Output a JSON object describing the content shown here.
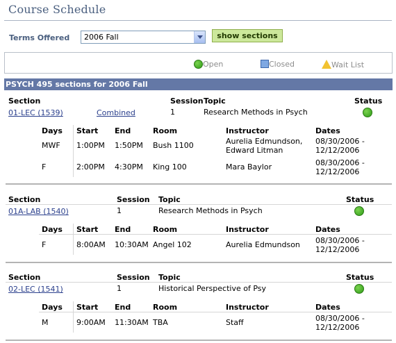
{
  "page": {
    "title": "Course Schedule"
  },
  "filter": {
    "label": "Terms Offered",
    "selected": "2006 Fall",
    "button": "show sections"
  },
  "legend": {
    "open": "Open",
    "closed": "Closed",
    "wait": "Wait List"
  },
  "banner": "PSYCH 495 sections for 2006 Fall",
  "section_headers": {
    "section": "Section",
    "session": "Session",
    "topic": "Topic",
    "status": "Status"
  },
  "meeting_headers": {
    "days": "Days",
    "start": "Start",
    "end": "End",
    "room": "Room",
    "instructor": "Instructor",
    "dates": "Dates"
  },
  "sections": [
    {
      "section": "01-LEC (1539)",
      "combined": "Combined",
      "session": "1",
      "topic": "Research Methods in Psych",
      "status": "Open",
      "meetings": [
        {
          "days": "MWF",
          "start": "1:00PM",
          "end": "1:50PM",
          "room": "Bush 1100",
          "instructor_1": "Aurelia Edmundson,",
          "instructor_2": "Edward Litman",
          "date_1": "08/30/2006 -",
          "date_2": "12/12/2006"
        },
        {
          "days": "F",
          "start": "2:00PM",
          "end": "4:30PM",
          "room": "King 100",
          "instructor_1": "Mara Baylor",
          "date_1": "08/30/2006 -",
          "date_2": "12/12/2006"
        }
      ]
    },
    {
      "section": "01A-LAB (1540)",
      "session": "1",
      "topic": "Research Methods in Psych",
      "status": "Open",
      "meetings": [
        {
          "days": "F",
          "start": "8:00AM",
          "end": "10:30AM",
          "room": "Angel 102",
          "instructor_1": "Aurelia Edmundson",
          "date_1": "08/30/2006 -",
          "date_2": "12/12/2006"
        }
      ]
    },
    {
      "section": "02-LEC (1541)",
      "session": "1",
      "topic": "Historical Perspective of Psy",
      "status": "Open",
      "meetings": [
        {
          "days": "M",
          "start": "9:00AM",
          "end": "11:30AM",
          "room": "TBA",
          "instructor_1": "Staff",
          "date_1": "08/30/2006 -",
          "date_2": "12/12/2006"
        }
      ]
    }
  ]
}
